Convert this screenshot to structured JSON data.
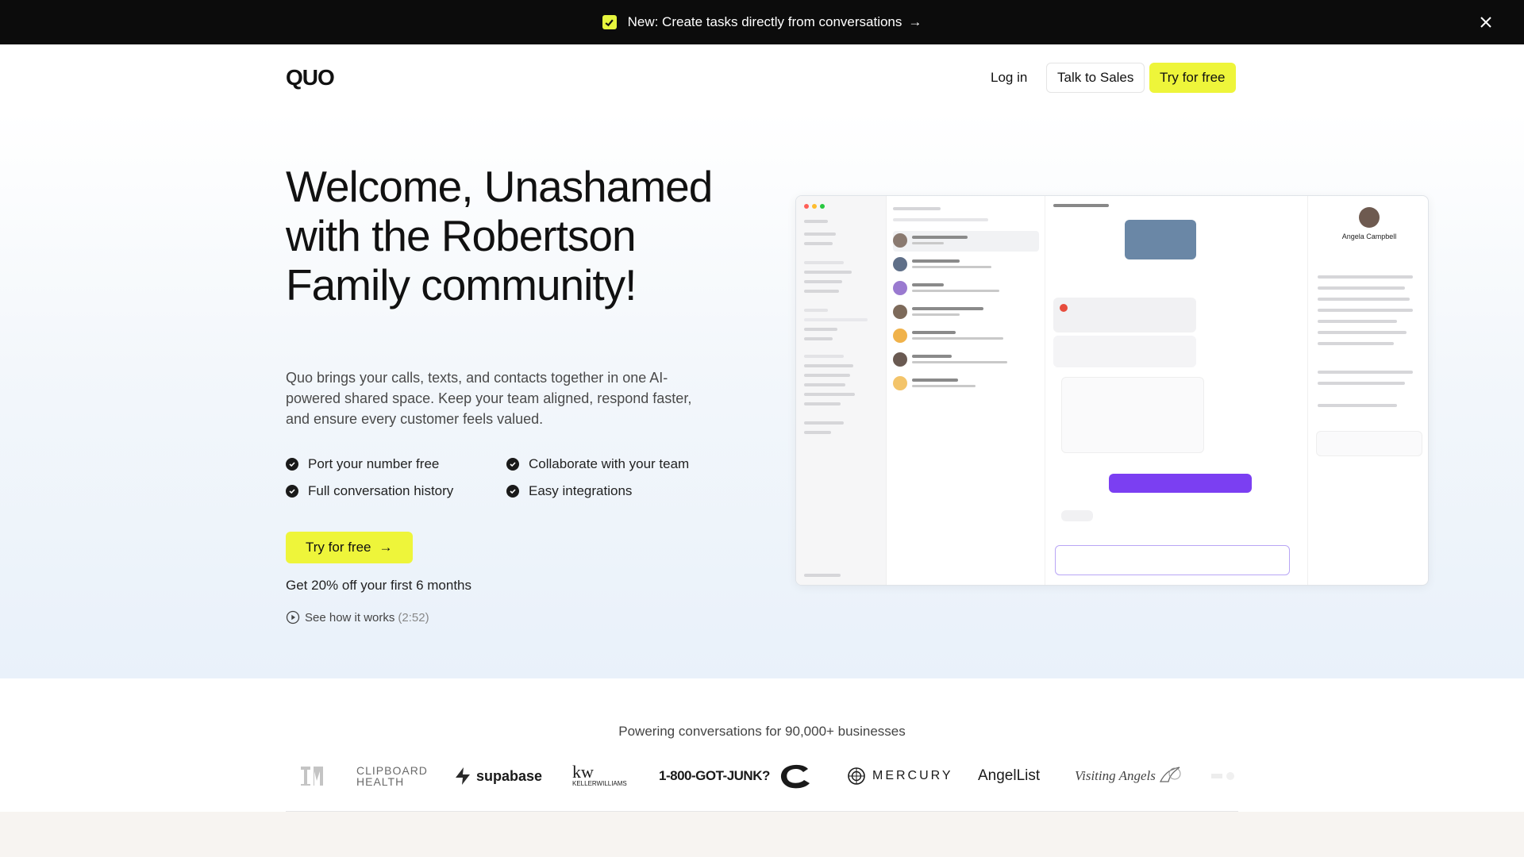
{
  "banner": {
    "text": "New: Create tasks directly from conversations",
    "arrow": "→"
  },
  "nav": {
    "logo": "QUO",
    "login": "Log in",
    "talk_to_sales": "Talk to Sales",
    "try_free": "Try for free"
  },
  "hero": {
    "title": "Welcome, Unashamed with the Robertson Family community!",
    "description": "Quo brings your calls, texts, and contacts together in one AI-powered shared space. Keep your team aligned, respond faster, and ensure every customer feels valued.",
    "features": [
      "Port your number free",
      "Collaborate with your team",
      "Full conversation history",
      "Easy integrations"
    ],
    "cta": "Try for free",
    "cta_arrow": "→",
    "discount": "Get 20% off your first 6 months",
    "see_how": "See how it works",
    "see_how_duration": "(2:52)"
  },
  "app_preview": {
    "contact_name": "Angela Campbell"
  },
  "logos": {
    "tagline": "Powering conversations for 90,000+ businesses",
    "items": [
      "CLIPBOARD",
      "HEALTH",
      "supabase",
      "kw",
      "KELLERWILLIAMS",
      "1-800-GOT-JUNK?",
      "MERCURY",
      "AngelList",
      "Visiting Angels"
    ]
  },
  "colors": {
    "accent": "#eef53a",
    "banner_bg": "#0c0c0c",
    "text": "#111111"
  }
}
